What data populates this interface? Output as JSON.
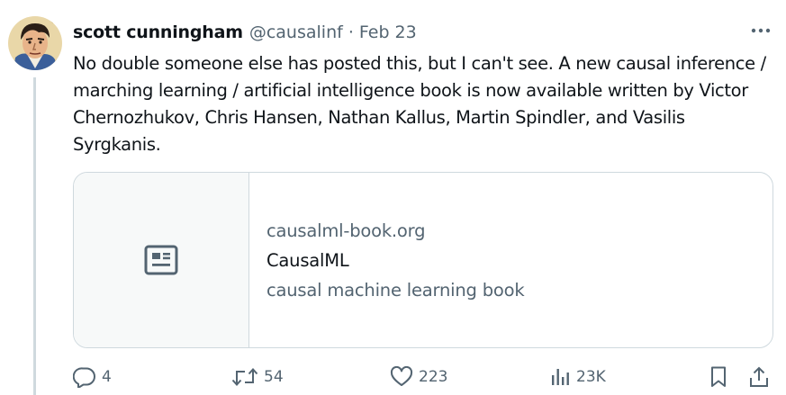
{
  "author": {
    "display_name": "scott cunningham",
    "handle": "@causalinf",
    "separator": "·",
    "date": "Feb 23",
    "avatar_icon": "comic-portrait-avatar"
  },
  "tweet": {
    "text": "No double someone else has posted this, but I can't see. A new causal inference / marching learning / artificial intelligence book is now available written by Victor Chernozhukov, Chris Hansen, Nathan Kallus, Martin Spindler, and Vasilis Syrgkanis."
  },
  "card": {
    "icon": "article-icon",
    "domain": "causalml-book.org",
    "title": "CausalML",
    "description": "causal machine learning book"
  },
  "actions": {
    "replies": "4",
    "reposts": "54",
    "likes": "223",
    "views": "23K"
  },
  "colors": {
    "text": "#0f1419",
    "secondary": "#536471",
    "border": "#cfd9de",
    "card_media_bg": "#f7f9f9"
  }
}
